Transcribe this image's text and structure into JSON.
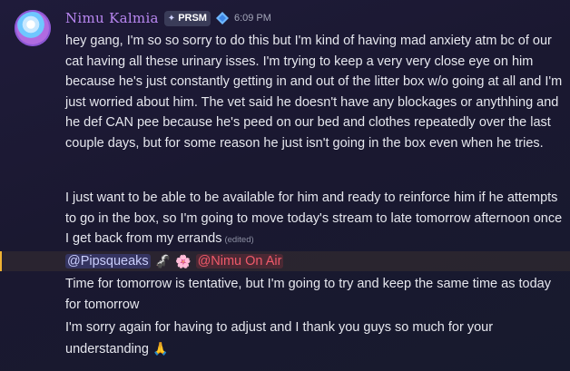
{
  "author": {
    "name": "Nimu Kalmia",
    "tag": "PRSM",
    "timestamp": "6:09 PM"
  },
  "messages": [
    {
      "text": "hey gang, I'm so so sorry to do this but I'm kind of having mad anxiety atm bc of our cat having all these urinary isses. I'm trying to keep a very very close eye on him because he's just constantly getting in and out of the litter box w/o going at all and I'm just worried about him. The vet said he doesn't have any blockages or anythhing and he def CAN pee because he's peed on our bed and clothes repeatedly over the last couple days, but for some reason he just isn't going in the box even when he tries."
    },
    {
      "text": "I just want to be able to be available for him and ready to reinforce him if he attempts to go in the box, so I'm going to move today's stream to late tomorrow afternoon once I get back from my errands",
      "edited": "(edited)"
    }
  ],
  "mentions": {
    "user": "@Pipsqueaks",
    "role": "@Nimu On Air",
    "emoji_1": "🦨",
    "emoji_2": "🌸"
  },
  "followups": [
    {
      "text": "Time for tomorrow is tentative, but I'm going to try and keep the same time as today for tomorrow"
    },
    {
      "text": "I'm sorry again for having to adjust and I thank you guys so much for your understanding",
      "emoji": "🙏"
    }
  ],
  "colors": {
    "username": "#b886f0",
    "mention_highlight": "#f0b232",
    "role_mention": "#f0596a"
  }
}
